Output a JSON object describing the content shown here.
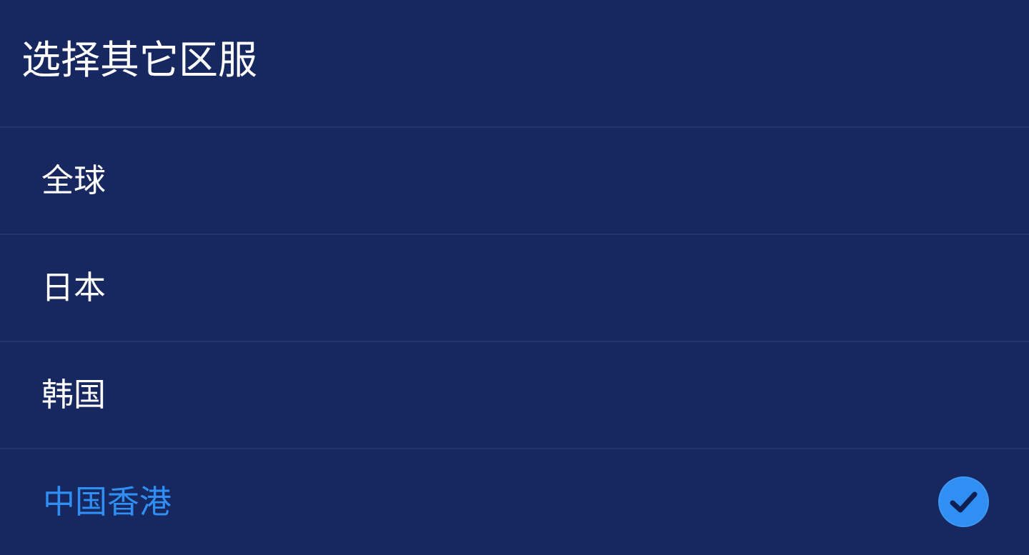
{
  "dialog": {
    "title": "选择其它区服"
  },
  "regions": [
    {
      "label": "全球",
      "selected": false
    },
    {
      "label": "日本",
      "selected": false
    },
    {
      "label": "韩国",
      "selected": false
    },
    {
      "label": "中国香港",
      "selected": true
    }
  ],
  "icons": {
    "selected": "check-circle-icon"
  },
  "colors": {
    "background": "#17275f",
    "divider": "#24346f",
    "text": "#ffffff",
    "accent": "#2f8ff2",
    "check_mark": "#0f1f52"
  }
}
